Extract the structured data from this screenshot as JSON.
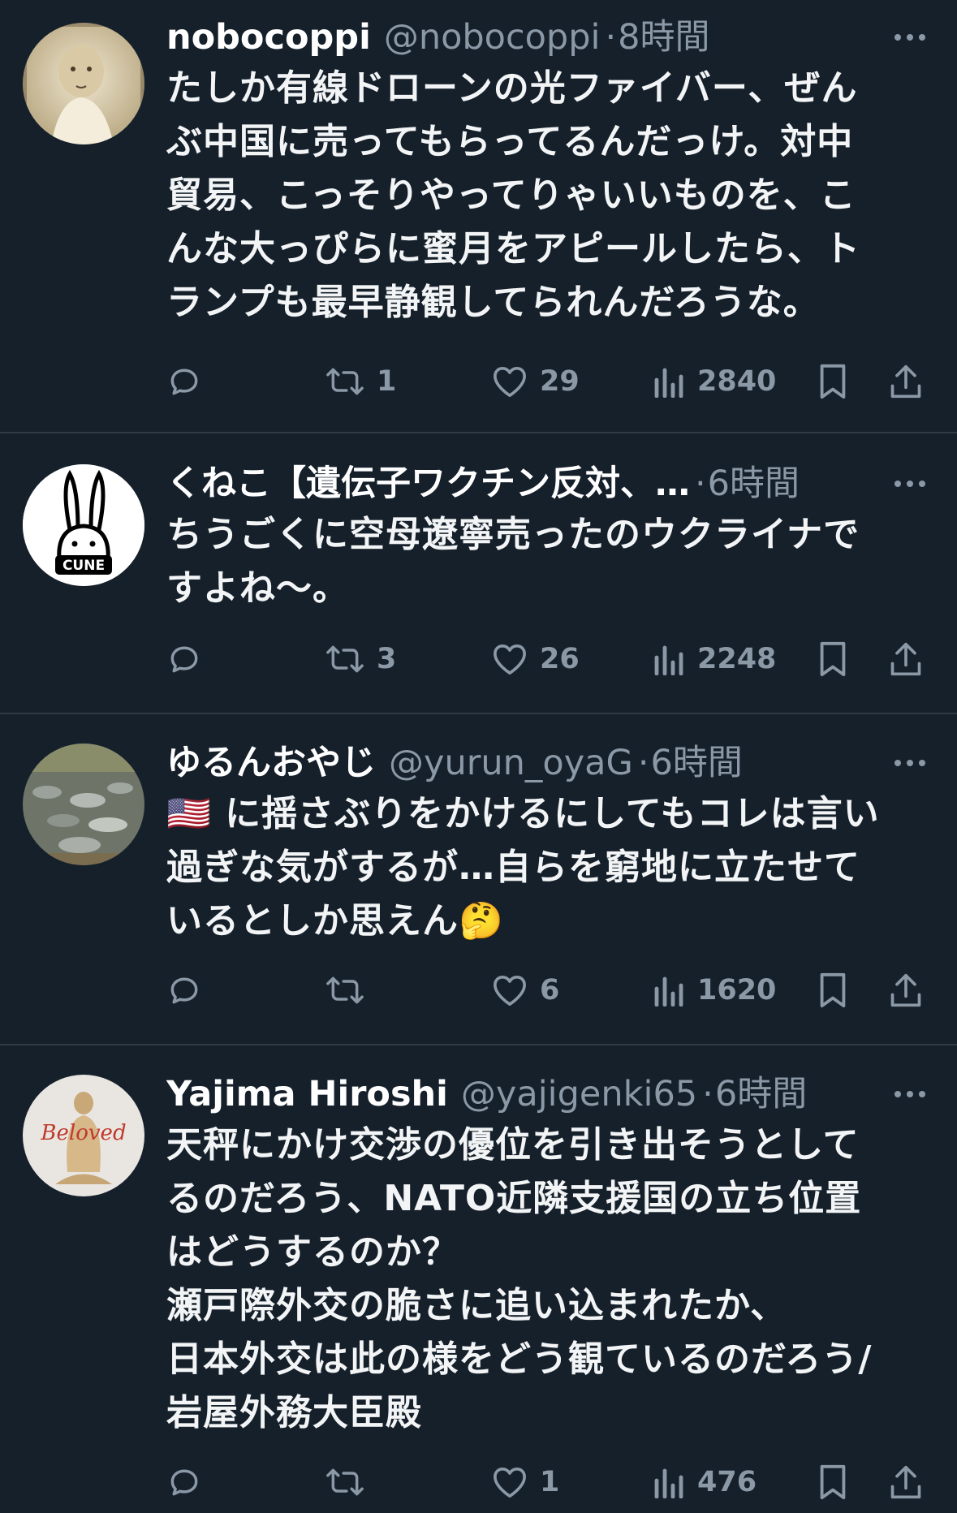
{
  "tweets": [
    {
      "name": "nobocoppi",
      "handle": "@nobocoppi",
      "separator": "·",
      "time": "8時間",
      "text": "たしか有線ドローンの光ファイバー、ぜん\nぶ中国に売ってもらってるんだっけ。対中\n貿易、こっそりやってりゃいいものを、こ\nんな大っぴらに蜜月をアピールしたら、ト\nランプも最早静観してられんだろうな。",
      "retweets": "1",
      "likes": "29",
      "views": "2840"
    },
    {
      "name": "くねこ【遺伝子ワクチン反対、…",
      "handle": "",
      "separator": "·",
      "time": "6時間",
      "text": "ちうごくに空母遼寧売ったのウクライナで\nすよね〜。",
      "avatar_logo_text": "CUNE",
      "retweets": "3",
      "likes": "26",
      "views": "2248"
    },
    {
      "name": "ゆるんおやじ",
      "handle": "@yurun_oyaG",
      "separator": "·",
      "time": "6時間",
      "flag_emoji": "🇺🇸",
      "text_main": " に揺さぶりをかけるにしてもコレは言い\n過ぎな気がするが…自らを窮地に立たせて\nいるとしか思えん",
      "end_emoji": "🤔",
      "retweets": "",
      "likes": "6",
      "views": "1620"
    },
    {
      "name": "Yajima Hiroshi",
      "handle": "@yajigenki65",
      "separator": "·",
      "time": "6時間",
      "text": "天秤にかけ交渉の優位を引き出そうとして\nるのだろう、NATO近隣支援国の立ち位置\nはどうするのか？\n瀬戸際外交の脆さに追い込まれたか、\n日本外交は此の様をどう観ているのだろう/\n岩屋外務大臣殿",
      "avatar_logo_text": "Beloved",
      "retweets": "",
      "likes": "1",
      "views": "476"
    }
  ],
  "colors": {
    "background": "#15202b",
    "text": "#e7e9ea",
    "secondary": "#8b98a5",
    "divider": "#2f3a45"
  },
  "icons": [
    "reply-icon",
    "retweet-icon",
    "like-icon",
    "views-icon",
    "bookmark-icon",
    "share-icon",
    "more-icon"
  ]
}
